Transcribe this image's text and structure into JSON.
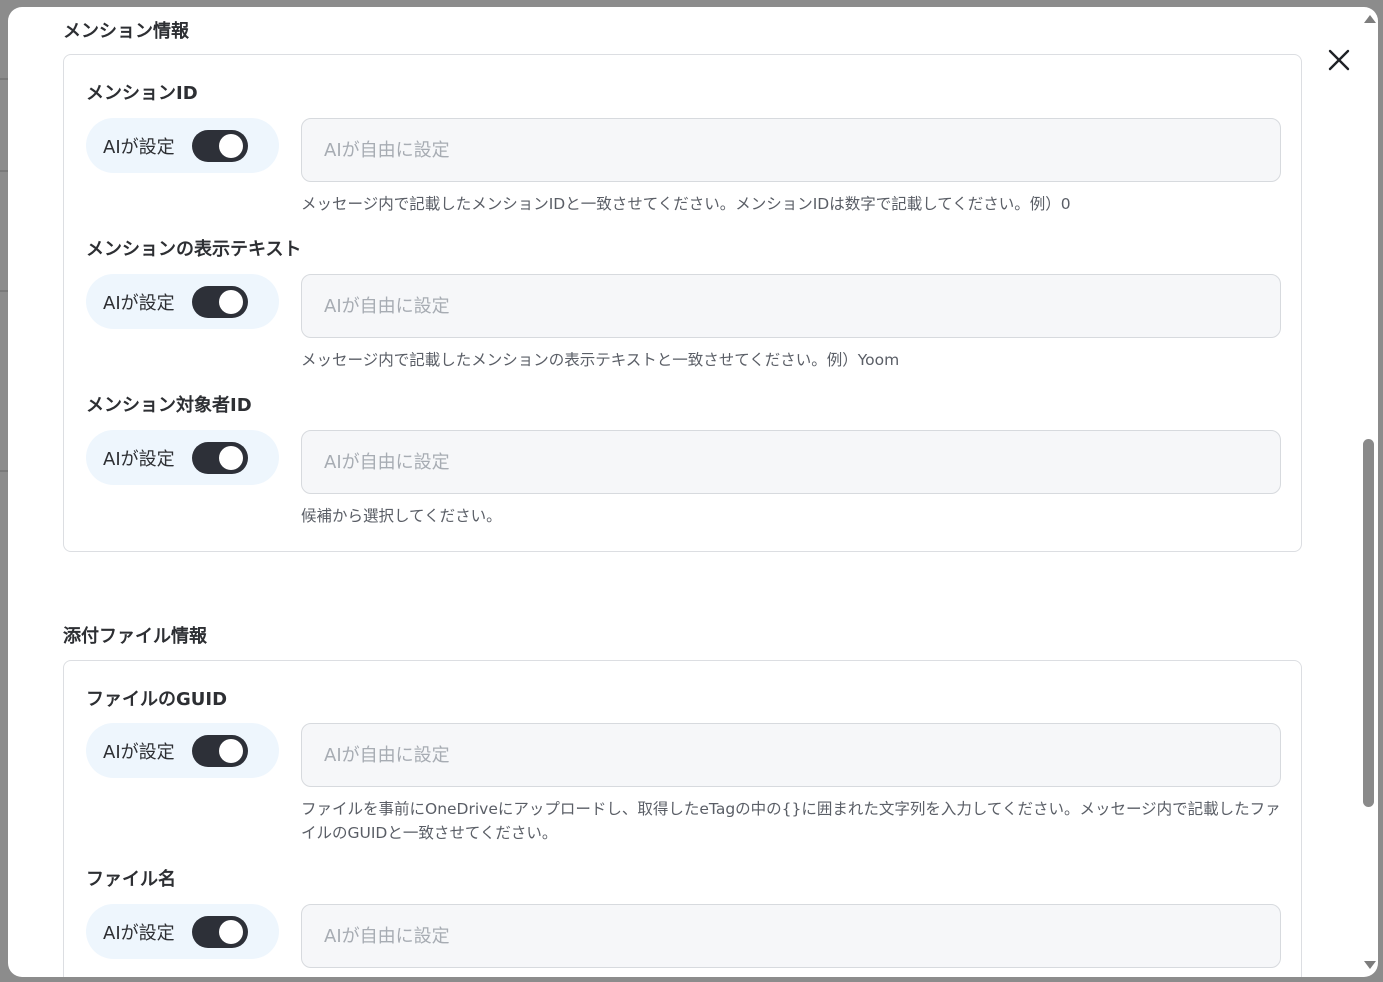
{
  "sections": [
    {
      "title": "メンション情報",
      "fields": [
        {
          "label": "メンションID",
          "toggle_label": "AIが設定",
          "placeholder": "AIが自由に設定",
          "help": "メッセージ内で記載したメンションIDと一致させてください。メンションIDは数字で記載してください。例）0"
        },
        {
          "label": "メンションの表示テキスト",
          "toggle_label": "AIが設定",
          "placeholder": "AIが自由に設定",
          "help": "メッセージ内で記載したメンションの表示テキストと一致させてください。例）Yoom"
        },
        {
          "label": "メンション対象者ID",
          "toggle_label": "AIが設定",
          "placeholder": "AIが自由に設定",
          "help": "候補から選択してください。"
        }
      ]
    },
    {
      "title": "添付ファイル情報",
      "fields": [
        {
          "label": "ファイルのGUID",
          "toggle_label": "AIが設定",
          "placeholder": "AIが自由に設定",
          "help": "ファイルを事前にOneDriveにアップロードし、取得したeTagの中の{}に囲まれた文字列を入力してください。メッセージ内で記載したファイルのGUIDと一致させてください。"
        },
        {
          "label": "ファイル名",
          "toggle_label": "AIが設定",
          "placeholder": "AIが自由に設定"
        }
      ]
    }
  ],
  "icons": {
    "close": "close-icon",
    "toggle": "toggle-switch"
  },
  "colors": {
    "toggle_on": "#2d3038",
    "pill_bg": "#eef6fd",
    "input_bg": "#f6f7f9"
  }
}
